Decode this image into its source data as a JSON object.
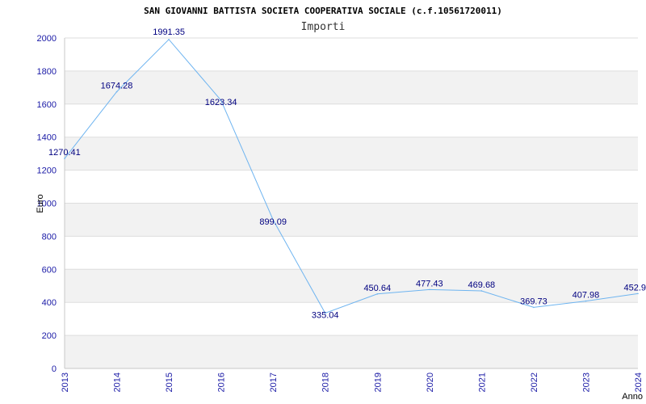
{
  "chart_data": {
    "type": "line",
    "title": "SAN GIOVANNI BATTISTA SOCIETA COOPERATIVA SOCIALE (c.f.10561720011)",
    "subtitle": "Importi",
    "xlabel": "Anno",
    "ylabel": "Euro",
    "categories": [
      "2013",
      "2014",
      "2015",
      "2016",
      "2017",
      "2018",
      "2019",
      "2020",
      "2021",
      "2022",
      "2023",
      "2024"
    ],
    "values": [
      1270.41,
      1674.28,
      1991.35,
      1623.34,
      899.09,
      335.04,
      450.64,
      477.43,
      469.68,
      369.73,
      407.98,
      452.9
    ],
    "value_labels": [
      "1270.41",
      "1674.28",
      "1991.35",
      "1623.34",
      "899.09",
      "335.04",
      "450.64",
      "477.43",
      "469.68",
      "369.73",
      "407.98",
      "452.9"
    ],
    "ylim": [
      0,
      2000
    ],
    "yticks": [
      0,
      200,
      400,
      600,
      800,
      1000,
      1200,
      1400,
      1600,
      1800,
      2000
    ],
    "grid": true,
    "colors": {
      "line": "#6eb4f0",
      "band": "#f2f2f2",
      "grid": "#dddddd",
      "tick_text": "#1a1aa6",
      "data_label": "#000080"
    }
  }
}
